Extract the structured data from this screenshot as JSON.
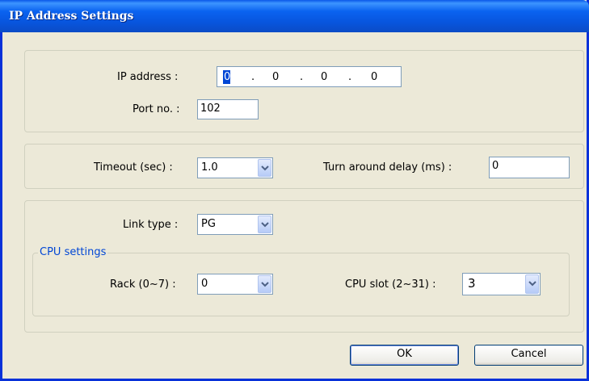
{
  "window": {
    "title": "IP Address Settings"
  },
  "ip": {
    "label": "IP address :",
    "octets": [
      "0",
      "0",
      "0",
      "0"
    ],
    "separator": "."
  },
  "port": {
    "label": "Port no. :",
    "value": "102"
  },
  "timeout": {
    "label": "Timeout (sec) :",
    "value": "1.0"
  },
  "turnaround": {
    "label": "Turn around delay (ms) :",
    "value": "0"
  },
  "link": {
    "label": "Link type :",
    "value": "PG"
  },
  "cpu": {
    "legend": "CPU settings",
    "rack_label": "Rack (0~7) :",
    "rack_value": "0",
    "slot_label": "CPU slot (2~31) :",
    "slot_value": "3"
  },
  "buttons": {
    "ok": "OK",
    "cancel": "Cancel"
  },
  "colors": {
    "titlebar": "#0855dd",
    "legend": "#0046d5",
    "dialog_bg": "#ece9d8"
  }
}
